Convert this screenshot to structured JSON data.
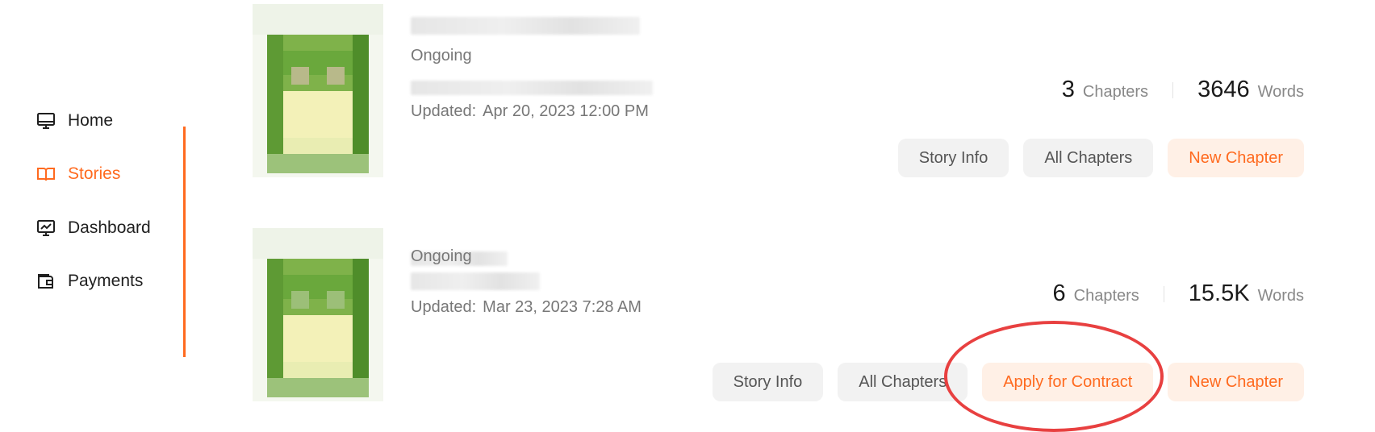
{
  "sidebar": {
    "items": [
      {
        "label": "Home",
        "icon": "monitor-icon",
        "active": false
      },
      {
        "label": "Stories",
        "icon": "book-icon",
        "active": true
      },
      {
        "label": "Dashboard",
        "icon": "chart-monitor-icon",
        "active": false
      },
      {
        "label": "Payments",
        "icon": "wallet-icon",
        "active": false
      }
    ]
  },
  "stories": [
    {
      "status": "Ongoing",
      "updated_label": "Updated:",
      "updated_value": "Apr 20, 2023 12:00 PM",
      "chapters": "3",
      "chapters_unit": "Chapters",
      "words": "3646",
      "words_unit": "Words",
      "buttons": {
        "story_info": "Story Info",
        "all_chapters": "All Chapters",
        "new_chapter": "New Chapter"
      }
    },
    {
      "status": "Ongoing",
      "updated_label": "Updated:",
      "updated_value": "Mar 23, 2023 7:28 AM",
      "chapters": "6",
      "chapters_unit": "Chapters",
      "words": "15.5K",
      "words_unit": "Words",
      "buttons": {
        "story_info": "Story Info",
        "all_chapters": "All Chapters",
        "apply_contract": "Apply for Contract",
        "new_chapter": "New Chapter"
      }
    }
  ],
  "colors": {
    "accent": "#ff6a1f",
    "annotation": "#e84040"
  }
}
